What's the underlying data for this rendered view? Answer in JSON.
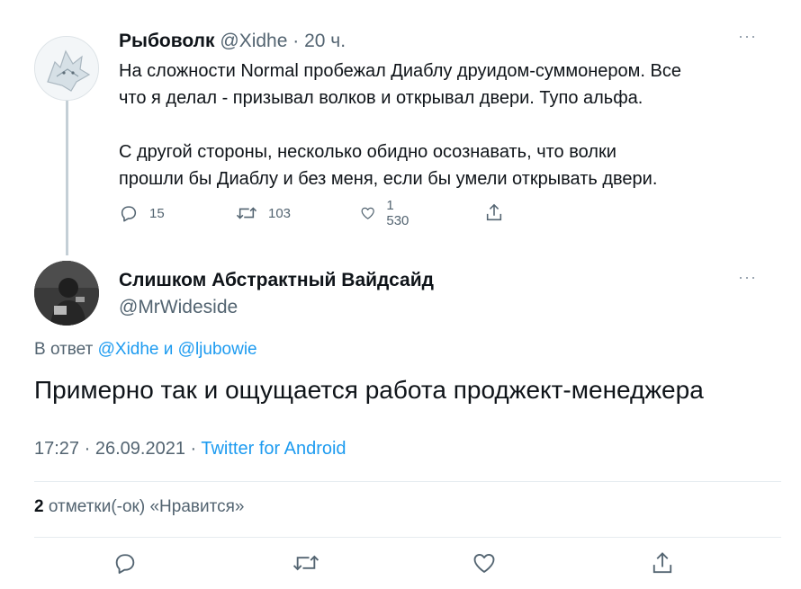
{
  "tweet1": {
    "author_name": "Рыбоволк",
    "handle": "@Xidhe",
    "separator": "·",
    "time": "20 ч.",
    "more": "···",
    "lines_p1": [
      "На сложности Normal пробежал Диаблу друидом-суммонером. Все",
      "что я делал - призывал волков и открывал двери. Тупо альфа."
    ],
    "lines_p2": [
      "С другой стороны, несколько обидно осознавать, что волки",
      "прошли бы Диаблу и без меня, если бы умели открывать двери."
    ],
    "replies": "15",
    "retweets": "103",
    "likes": "1 530"
  },
  "tweet2": {
    "author_name": "Слишком Абстрактный Вайдсайд",
    "handle": "@MrWideside",
    "more": "···",
    "reply_prefix": "В ответ ",
    "reply_user1": "@Xidhe",
    "reply_and": " и ",
    "reply_user2": "@ljubowie",
    "text": "Примерно так и ощущается работа проджект-менеджера",
    "time": "17:27",
    "separator": " · ",
    "date": "26.09.2021",
    "source": "Twitter for Android",
    "likes_count": "2",
    "likes_label": " отметки(-ок) «Нравится»"
  },
  "colors": {
    "link": "#1d9bf0",
    "muted": "#536471",
    "text": "#0f1419",
    "thread_line": "#c4cfd6"
  },
  "icons": [
    "reply-icon",
    "retweet-icon",
    "like-icon",
    "share-icon",
    "more-icon"
  ]
}
